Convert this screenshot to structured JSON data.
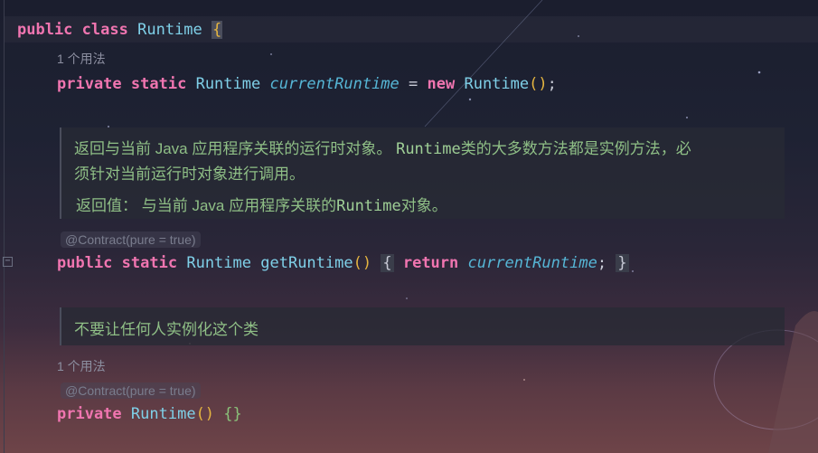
{
  "lines": {
    "class_decl": {
      "kw_public": "public",
      "kw_class": "class",
      "class_name": "Runtime",
      "open_brace": "{"
    },
    "usage_hint_1": "1 个用法",
    "field_decl": {
      "kw_private": "private",
      "kw_static": "static",
      "type": "Runtime",
      "name": "currentRuntime",
      "eq": " = ",
      "kw_new": "new",
      "ctor": "Runtime",
      "parens": "()",
      "semicolon": ";"
    },
    "doc_comment_1": {
      "line1_a": "返回与当前 Java 应用程序关联的运行时对象。 ",
      "line1_code": "Runtime",
      "line1_b": "类的大多数方法都是实例方法，必",
      "line2": "须针对当前运行时对象进行调用。",
      "returns_label": "返回值：",
      "returns_a": " 与当前 Java 应用程序关联的",
      "returns_code": "Runtime",
      "returns_b": "对象。"
    },
    "annotation_1": "@Contract(pure = true)",
    "method_decl": {
      "kw_public": "public",
      "kw_static": "static",
      "type": "Runtime",
      "name": "getRuntime",
      "parens": "()",
      "open": "{",
      "kw_return": "return",
      "ret_value": "currentRuntime",
      "semicolon": ";",
      "close": "}"
    },
    "doc_comment_2": "不要让任何人实例化这个类",
    "usage_hint_2": "1 个用法",
    "annotation_2": "@Contract(pure = true)",
    "ctor_decl": {
      "kw_private": "private",
      "name": "Runtime",
      "parens": "()",
      "body": "{}"
    }
  },
  "gutter": {
    "fold_icon": "minus-icon"
  }
}
